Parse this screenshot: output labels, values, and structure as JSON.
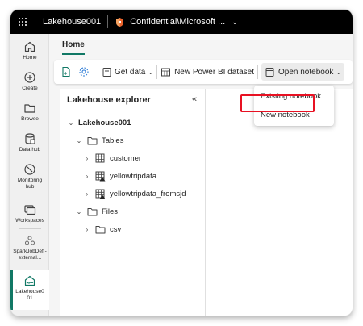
{
  "topbar": {
    "app_title": "Lakehouse001",
    "sensitivity_label": "Confidential\\Microsoft ...",
    "icons": [
      "waffle-icon",
      "sensitivity-icon",
      "chevron-down-icon"
    ]
  },
  "rail": {
    "items": [
      {
        "label": "Home",
        "icon": "home-icon"
      },
      {
        "label": "Create",
        "icon": "plus-circle-icon"
      },
      {
        "label": "Browse",
        "icon": "folder-icon"
      },
      {
        "label": "Data hub",
        "icon": "database-icon"
      },
      {
        "label": "Monitoring hub",
        "icon": "monitor-icon"
      },
      {
        "label": "Workspaces",
        "icon": "workspaces-icon"
      },
      {
        "label": "SparkJobDef -external...",
        "icon": "spark-job-icon"
      },
      {
        "label": "Lakehouse0 01",
        "icon": "lakehouse-icon"
      }
    ],
    "active_color": "#117865"
  },
  "tabs": {
    "home": "Home"
  },
  "ribbon": {
    "get_data": "Get data",
    "new_power_bi_dataset": "New Power BI dataset",
    "open_notebook": "Open notebook"
  },
  "explorer": {
    "title": "Lakehouse explorer",
    "collapse_glyph": "«",
    "tree": {
      "root": "Lakehouse001",
      "tables_folder": "Tables",
      "tables": [
        "customer",
        "yellowtripdata",
        "yellowtripdata_fromsjd"
      ],
      "files_folder": "Files",
      "files": [
        "csv"
      ]
    }
  },
  "dropdown": {
    "items": [
      "Existing notebook",
      "New notebook"
    ],
    "highlight_color": "#e81123"
  }
}
